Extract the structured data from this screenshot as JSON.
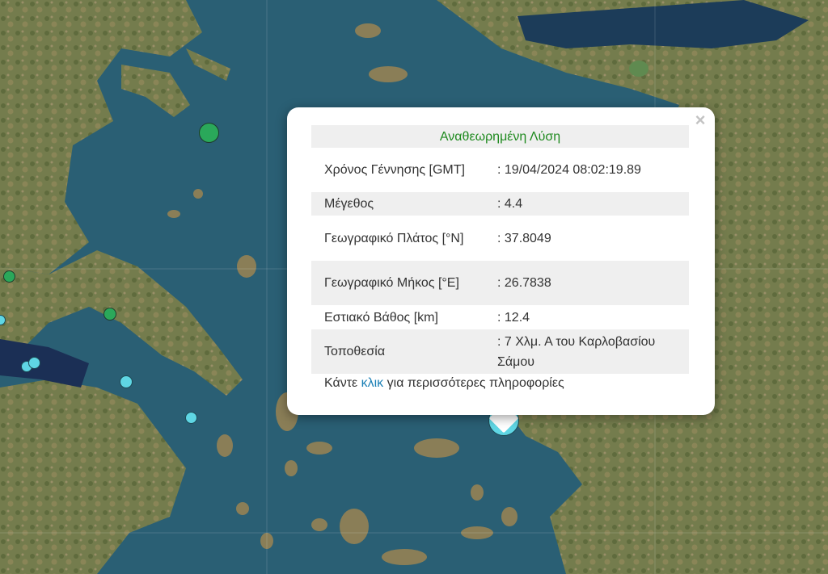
{
  "popup": {
    "title": "Αναθεωρημένη Λύση",
    "close_glyph": "×",
    "rows": [
      {
        "label": "Χρόνος Γέννησης [GMT]",
        "value": ": 19/04/2024 08:02:19.89"
      },
      {
        "label": "Μέγεθος",
        "value": ": 4.4"
      },
      {
        "label": "Γεωγραφικό Πλάτος [°N]",
        "value": ": 37.8049"
      },
      {
        "label": "Γεωγραφικό Μήκος [°E]",
        "value": ": 26.7838"
      },
      {
        "label": "Εστιακό Βάθος [km]",
        "value": ": 12.4"
      },
      {
        "label": "Τοποθεσία",
        "value": ": 7 Χλμ. Α του Καρλοβασίου Σάμου"
      }
    ],
    "footer_prefix": "Κάντε ",
    "footer_link": "κλικ",
    "footer_suffix": " για περισσότερες πληροφορίες"
  },
  "colors": {
    "sea": "#2a5f74",
    "land": "#6f7a4a",
    "marker_green": "#2aa85a",
    "marker_cyan": "#5fd6e4",
    "title_green": "#1f8a1f",
    "link_blue": "#1a7fb5"
  }
}
